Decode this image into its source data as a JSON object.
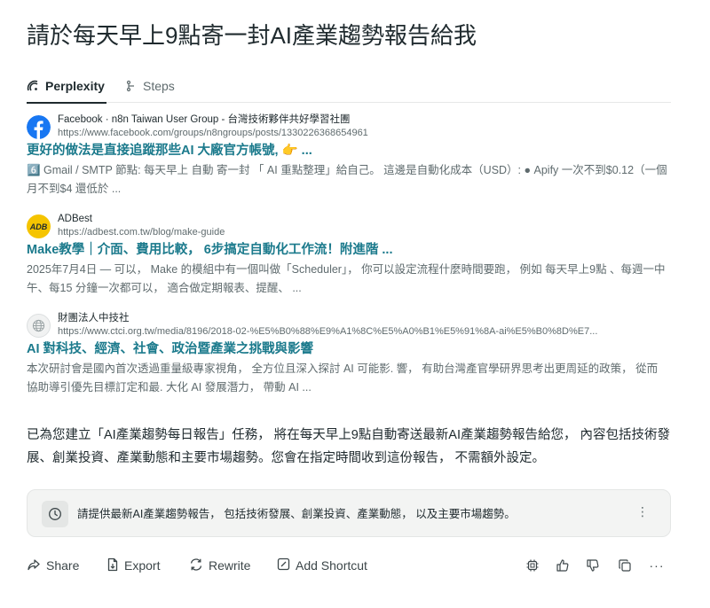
{
  "page": {
    "title": "請於每天早上9點寄一封AI產業趨勢報告給我"
  },
  "tabs": [
    {
      "label": "Perplexity",
      "icon": "perplexity-icon",
      "active": true
    },
    {
      "label": "Steps",
      "icon": "steps-icon",
      "active": false
    }
  ],
  "sources": [
    {
      "name": "Facebook · n8n Taiwan User Group - 台灣技術夥伴共好學習社團",
      "url": "https://www.facebook.com/groups/n8ngroups/posts/1330226368654961",
      "title": "更好的做法是直接追蹤那些AI 大廠官方帳號, 👉 ...",
      "snippet": "6️⃣ Gmail / SMTP 節點: 每天早上 自動 寄一封 「 AI 重點整理」給自己。 這邊是自動化成本（USD）: ● Apify 一次不到$0.12（一個月不到$4 還低於 ...",
      "icon": "facebook-icon",
      "icon_color": "#1877f2"
    },
    {
      "name": "ADBest",
      "url": "https://adbest.com.tw/blog/make-guide",
      "title": "Make教學｜介面、費用比較， 6步搞定自動化工作流！附進階 ...",
      "snippet": "2025年7月4日 — 可以， Make 的模組中有一個叫做「Scheduler」， 你可以設定流程什麼時間要跑， 例如 每天早上9點 、每週一中午、每15 分鐘一次都可以， 適合做定期報表、提醒、 ...",
      "icon": "adbest-logo-icon",
      "icon_text": "ADB",
      "icon_color": "#f5c400"
    },
    {
      "name": "財團法人中技社",
      "url": "https://www.ctci.org.tw/media/8196/2018-02-%E5%B0%88%E9%A1%8C%E5%A0%B1%E5%91%8A-ai%E5%B0%8D%E7...",
      "title": "AI 對科技、經濟、社會、政治暨產業之挑戰與影響",
      "snippet": "本次研討會是國內首次透過重量級專家視角， 全方位且深入探討 AI 可能影. 響， 有助台灣產官學研界思考出更周延的政策， 從而協助導引優先目標訂定和最. 大化 AI 發展潛力， 帶動 AI ...",
      "icon": "globe-icon",
      "icon_color": "#9aa3a5"
    }
  ],
  "answer": {
    "text": "已為您建立「AI產業趨勢每日報告」任務， 將在每天早上9點自動寄送最新AI產業趨勢報告給您， 內容包括技術發展、創業投資、產業動態和主要市場趨勢。您會在指定時間收到這份報告， 不需額外設定。"
  },
  "followup": {
    "text": "請提供最新AI產業趨勢報告， 包括技術發展、創業投資、產業動態， 以及主要市場趨勢。",
    "icon": "clock-icon",
    "menu": "⋮"
  },
  "actions": {
    "share": "Share",
    "export": "Export",
    "rewrite": "Rewrite",
    "add_shortcut": "Add Shortcut",
    "more": "···"
  },
  "colors": {
    "accent_link": "#1b7a8c",
    "text_primary": "#1f2a2e",
    "text_muted": "#5f6b6e"
  }
}
